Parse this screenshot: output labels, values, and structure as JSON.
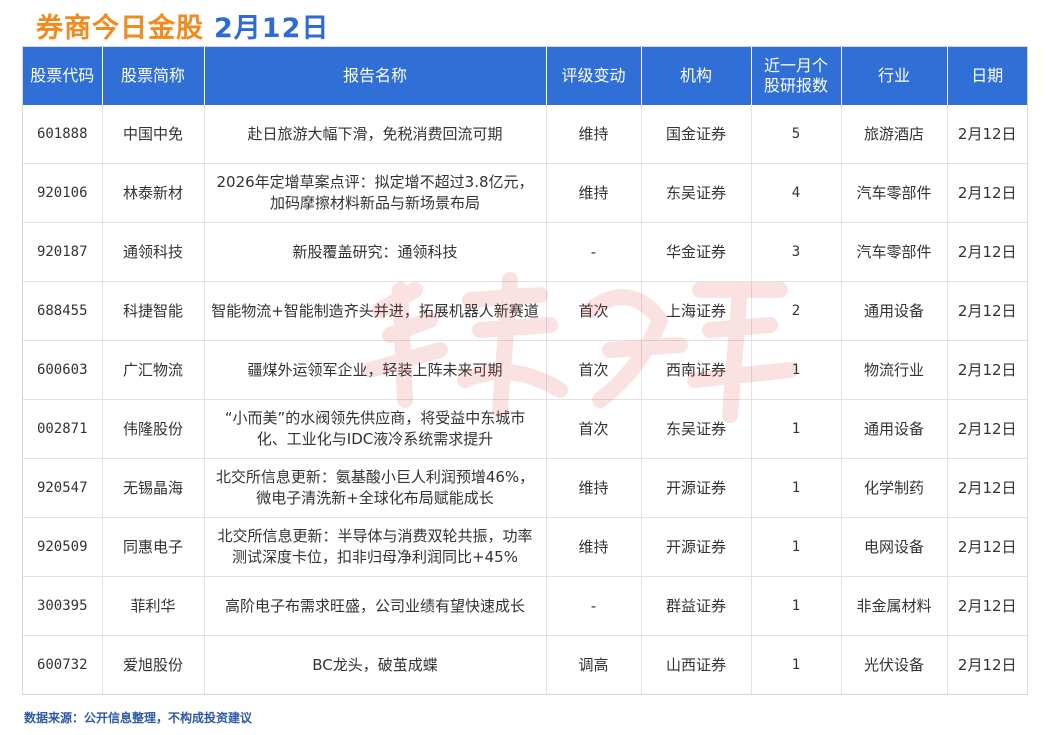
{
  "header": {
    "title": "券商今日金股",
    "date": "2月12日"
  },
  "table": {
    "columns": [
      "股票代码",
      "股票简称",
      "报告名称",
      "评级变动",
      "机构",
      "近一月个股研报数",
      "行业",
      "日期"
    ],
    "rows": [
      {
        "code": "601888",
        "name": "中国中免",
        "report": "赴日旅游大幅下滑，免税消费回流可期",
        "rating": "维持",
        "org": "国金证券",
        "count": "5",
        "industry": "旅游酒店",
        "date": "2月12日"
      },
      {
        "code": "920106",
        "name": "林泰新材",
        "report": "2026年定增草案点评：拟定增不超过3.8亿元，加码摩擦材料新品与新场景布局",
        "rating": "维持",
        "org": "东吴证券",
        "count": "4",
        "industry": "汽车零部件",
        "date": "2月12日"
      },
      {
        "code": "920187",
        "name": "通领科技",
        "report": "新股覆盖研究：通领科技",
        "rating": "-",
        "org": "华金证券",
        "count": "3",
        "industry": "汽车零部件",
        "date": "2月12日"
      },
      {
        "code": "688455",
        "name": "科捷智能",
        "report": "智能物流+智能制造齐头并进，拓展机器人新赛道",
        "rating": "首次",
        "org": "上海证券",
        "count": "2",
        "industry": "通用设备",
        "date": "2月12日"
      },
      {
        "code": "600603",
        "name": "广汇物流",
        "report": "疆煤外运领军企业，轻装上阵未来可期",
        "rating": "首次",
        "org": "西南证券",
        "count": "1",
        "industry": "物流行业",
        "date": "2月12日"
      },
      {
        "code": "002871",
        "name": "伟隆股份",
        "report": "“小而美”的水阀领先供应商，将受益中东城市化、工业化与IDC液冷系统需求提升",
        "rating": "首次",
        "org": "东吴证券",
        "count": "1",
        "industry": "通用设备",
        "date": "2月12日"
      },
      {
        "code": "920547",
        "name": "无锡晶海",
        "report": "北交所信息更新：氨基酸小巨人利润预增46%，微电子清洗新+全球化布局赋能成长",
        "rating": "维持",
        "org": "开源证券",
        "count": "1",
        "industry": "化学制药",
        "date": "2月12日"
      },
      {
        "code": "920509",
        "name": "同惠电子",
        "report": "北交所信息更新：半导体与消费双轮共振，功率测试深度卡位，扣非归母净利润同比+45%",
        "rating": "维持",
        "org": "开源证券",
        "count": "1",
        "industry": "电网设备",
        "date": "2月12日"
      },
      {
        "code": "300395",
        "name": "菲利华",
        "report": "高阶电子布需求旺盛，公司业绩有望快速成长",
        "rating": "-",
        "org": "群益证券",
        "count": "1",
        "industry": "非金属材料",
        "date": "2月12日"
      },
      {
        "code": "600732",
        "name": "爱旭股份",
        "report": "BC龙头，破茧成蝶",
        "rating": "调高",
        "org": "山西证券",
        "count": "1",
        "industry": "光伏设备",
        "date": "2月12日"
      }
    ]
  },
  "footer": {
    "source": "数据来源：公开信息整理，不构成投资建议"
  },
  "colors": {
    "header_bg": "#2f6fd6",
    "title_orange": "#f28b1e",
    "title_blue": "#2e6bd6",
    "footer_text": "#2f5aa8",
    "watermark": "#e0303a"
  }
}
